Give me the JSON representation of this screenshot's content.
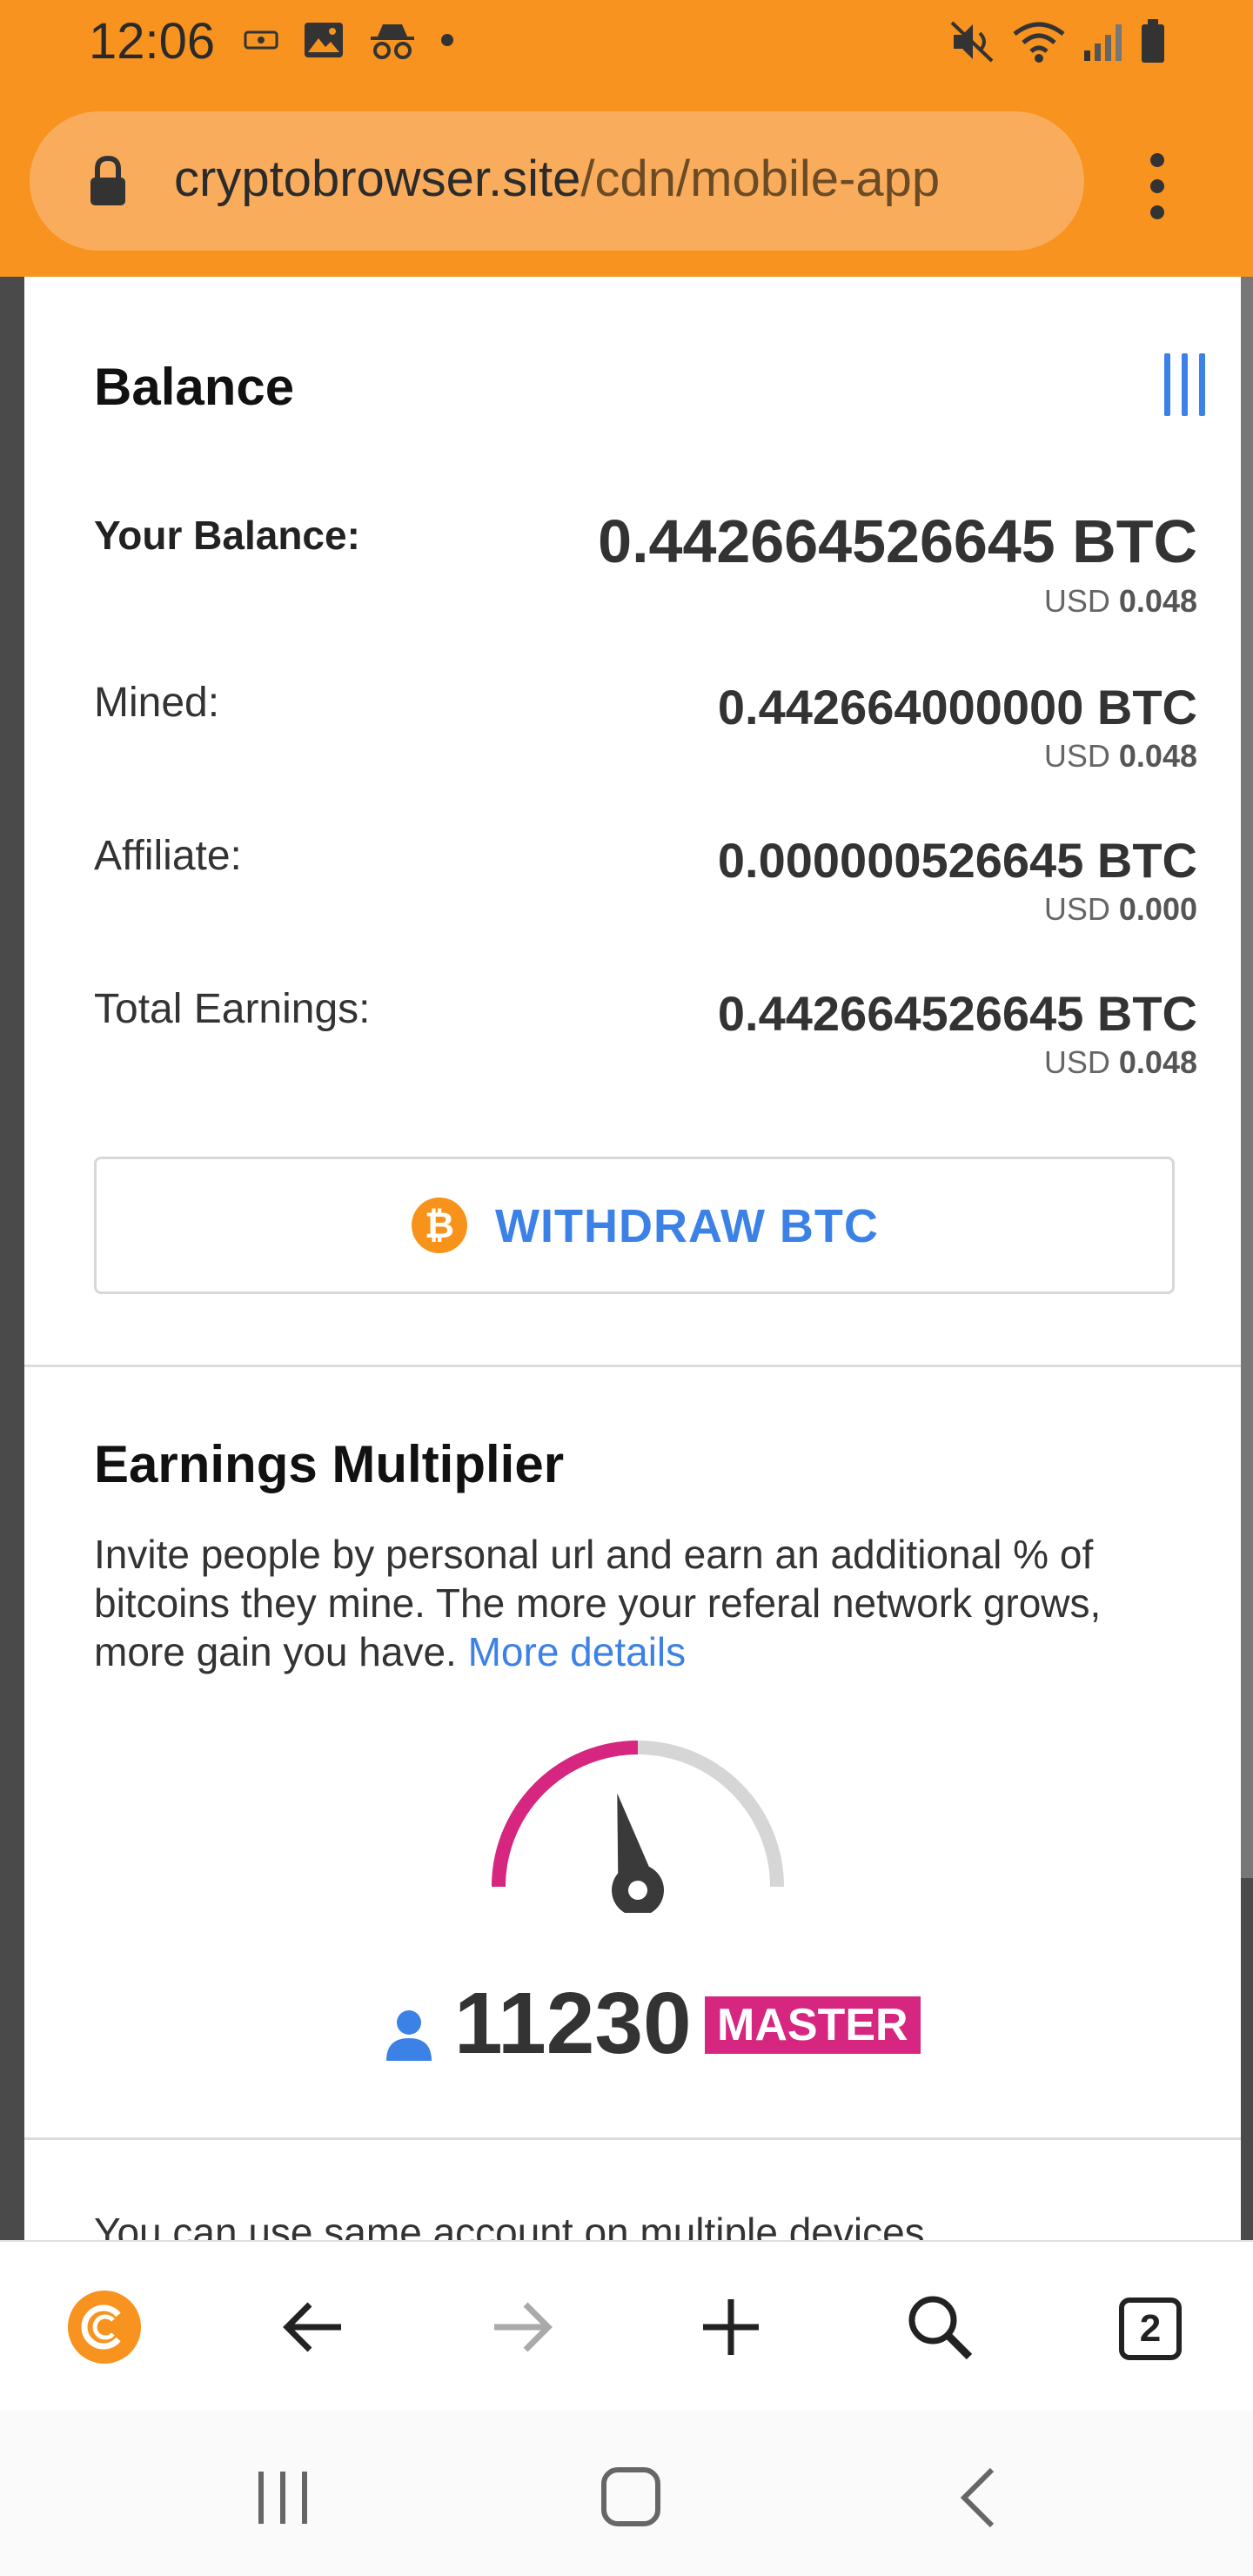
{
  "status_bar": {
    "time": "12:06",
    "left_icons": [
      "screen-record-icon",
      "gallery-icon",
      "incognito-icon",
      "dot-icon"
    ],
    "right_icons": [
      "mute-icon",
      "wifi-icon",
      "signal-icon",
      "battery-icon"
    ]
  },
  "url_bar": {
    "host": "cryptobrowser.site",
    "path": "/cdn/mobile-app"
  },
  "balance": {
    "title": "Balance",
    "rows": [
      {
        "label": "Your Balance:",
        "value": "0.442664526645 BTC",
        "usd_prefix": "USD",
        "usd": "0.048"
      },
      {
        "label": "Mined:",
        "value": "0.442664000000 BTC",
        "usd_prefix": "USD",
        "usd": "0.048"
      },
      {
        "label": "Affiliate:",
        "value": "0.000000526645 BTC",
        "usd_prefix": "USD",
        "usd": "0.000"
      },
      {
        "label": "Total Earnings:",
        "value": "0.442664526645 BTC",
        "usd_prefix": "USD",
        "usd": "0.048"
      }
    ],
    "withdraw_label": "WITHDRAW BTC",
    "btc_symbol": "₿"
  },
  "multiplier": {
    "title": "Earnings Multiplier",
    "description": "Invite people by personal url and earn an additional % of bitcoins they mine. The more your referal network grows, more gain you have.",
    "link_text": "More details",
    "gauge_fraction": 0.5,
    "count": "11230",
    "level": "MASTER"
  },
  "next_section_text": "You can use same account on multiple devices",
  "toolbar": {
    "tab_count": "2"
  },
  "colors": {
    "brand_orange": "#f7931e",
    "accent_blue": "#3c82e6",
    "badge_magenta": "#d6267f"
  }
}
